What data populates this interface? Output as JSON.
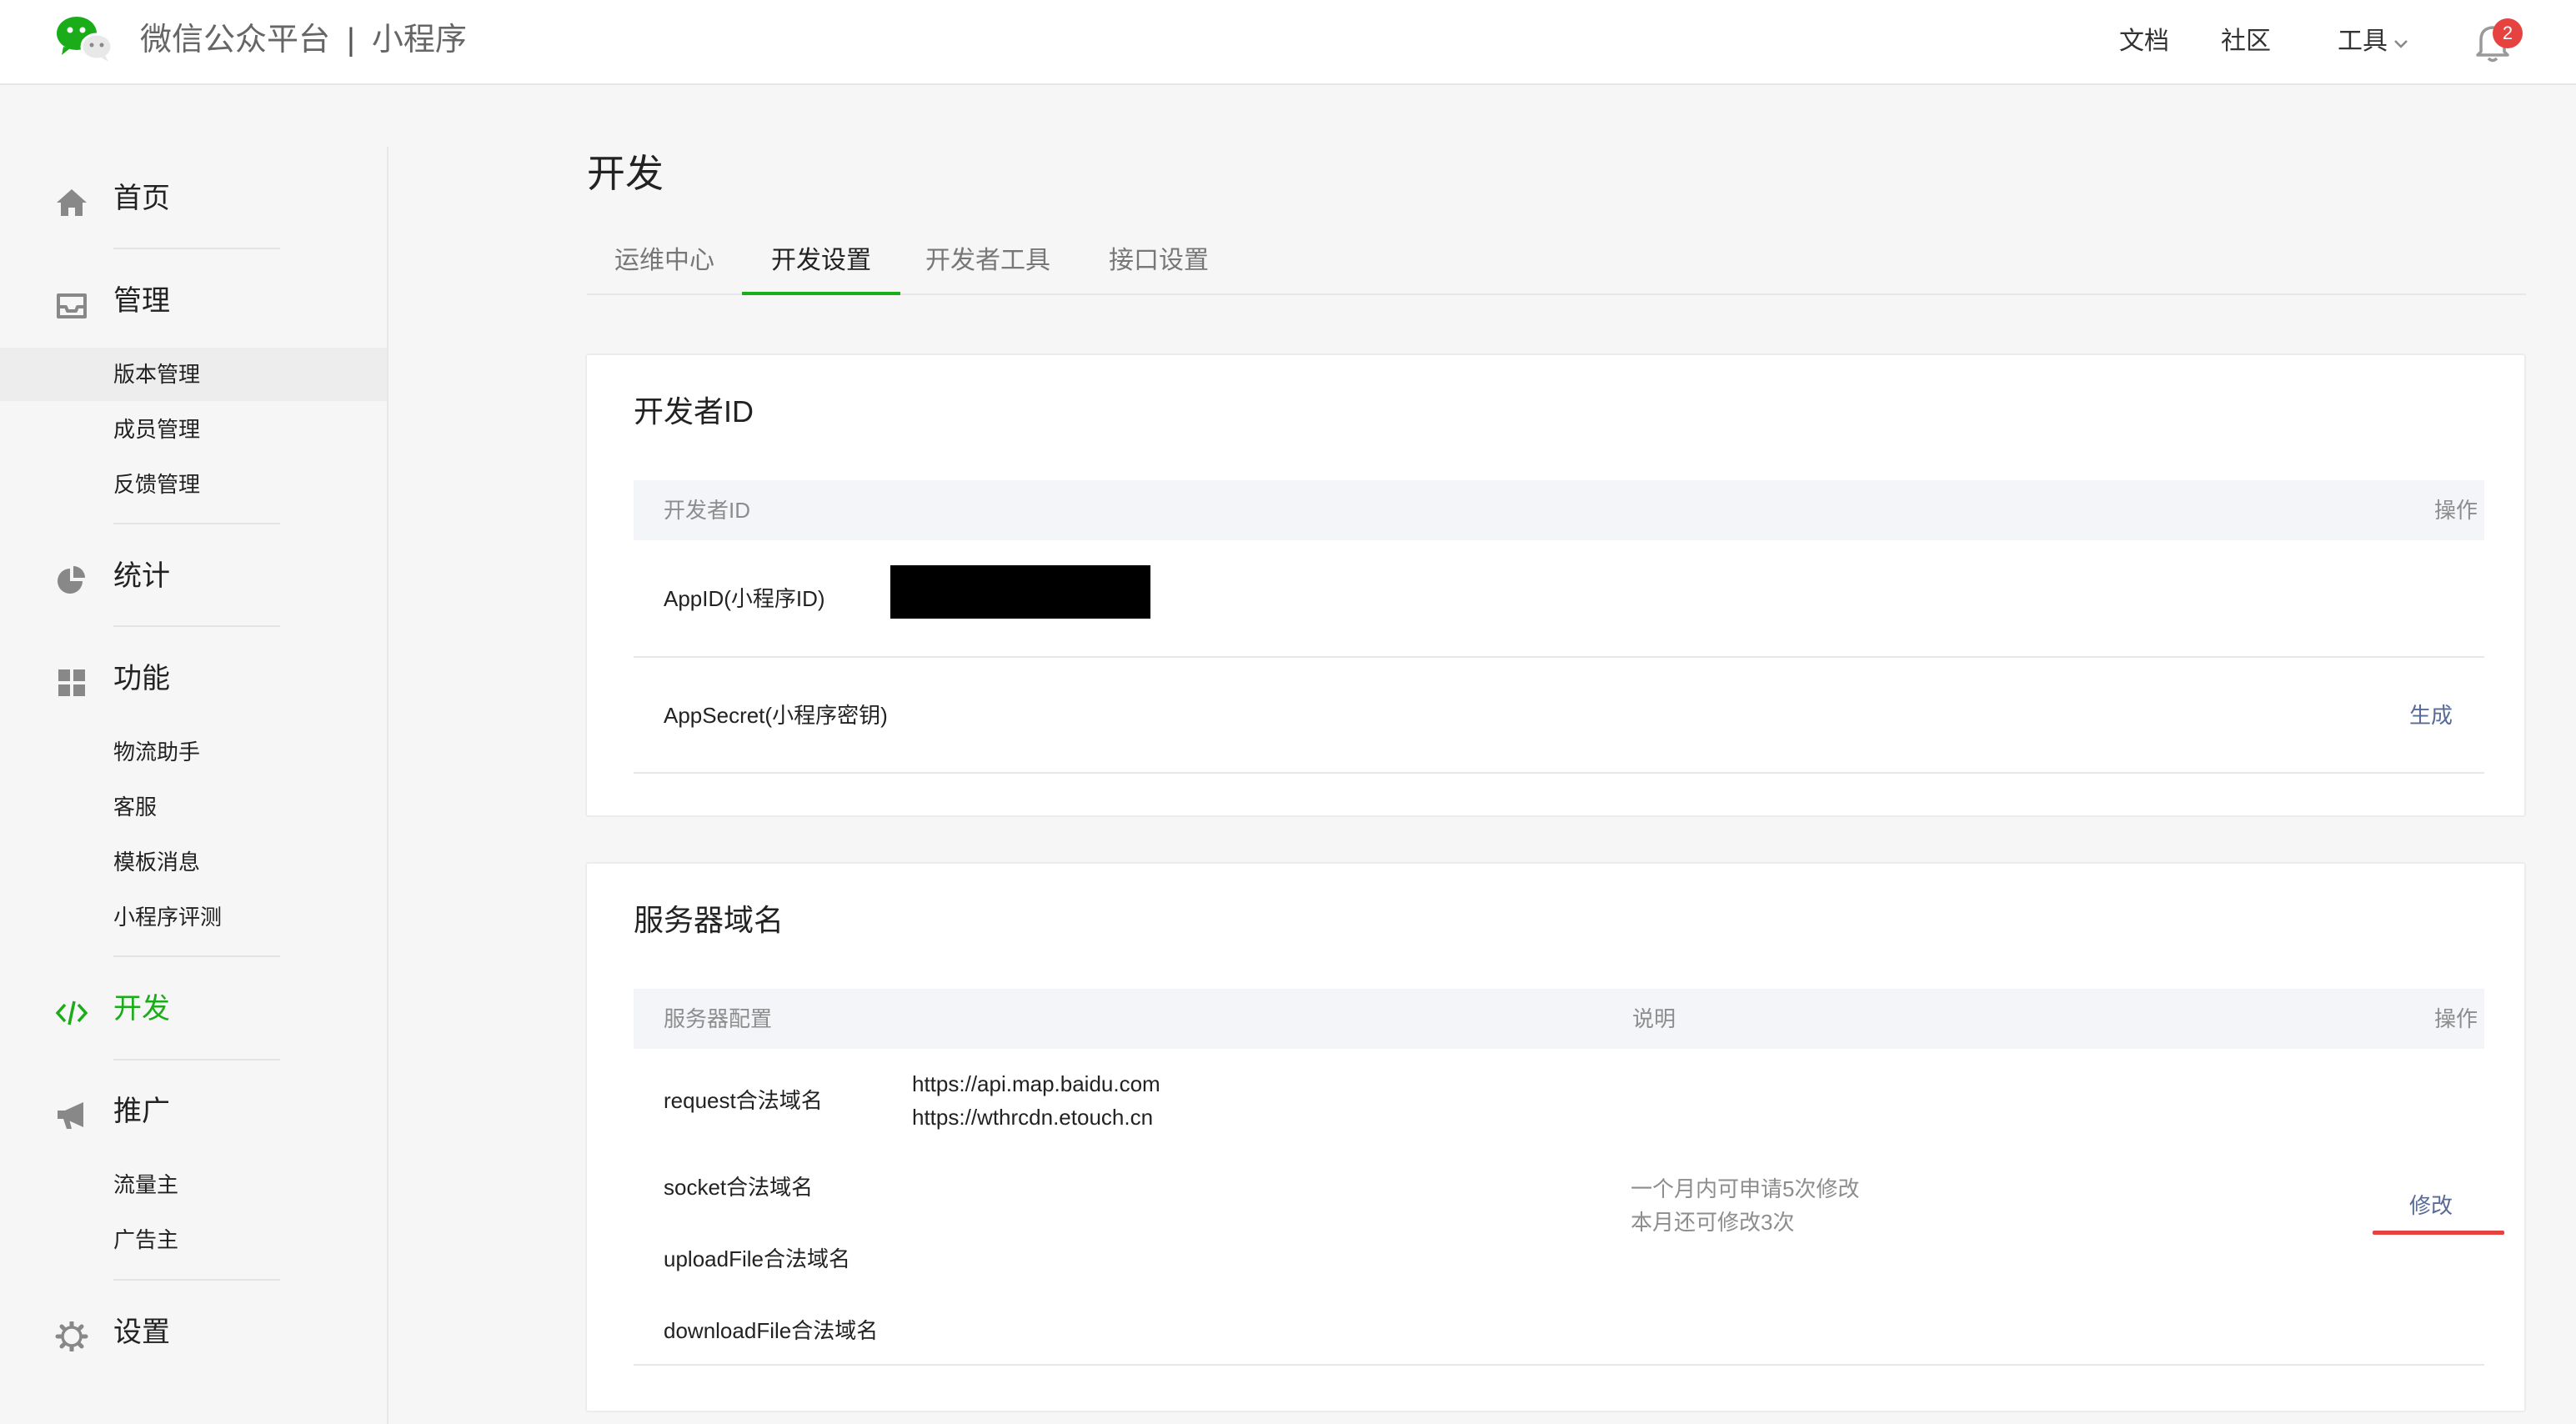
{
  "header": {
    "brand_name": "微信公众平台",
    "brand_separator": "|",
    "brand_product": "小程序",
    "nav": [
      {
        "label": "文档"
      },
      {
        "label": "社区"
      },
      {
        "label": "工具"
      }
    ],
    "notification_count": "2"
  },
  "sidebar": {
    "groups": [
      {
        "label": "首页",
        "icon": "home-icon",
        "items": []
      },
      {
        "label": "管理",
        "icon": "inbox-icon",
        "items": [
          {
            "label": "版本管理",
            "selected": true
          },
          {
            "label": "成员管理"
          },
          {
            "label": "反馈管理"
          }
        ]
      },
      {
        "label": "统计",
        "icon": "pie-chart-icon",
        "items": []
      },
      {
        "label": "功能",
        "icon": "grid-icon",
        "items": [
          {
            "label": "物流助手"
          },
          {
            "label": "客服"
          },
          {
            "label": "模板消息"
          },
          {
            "label": "小程序评测"
          }
        ]
      },
      {
        "label": "开发",
        "icon": "code-icon",
        "active": true,
        "items": []
      },
      {
        "label": "推广",
        "icon": "megaphone-icon",
        "items": [
          {
            "label": "流量主"
          },
          {
            "label": "广告主"
          }
        ]
      },
      {
        "label": "设置",
        "icon": "gear-icon",
        "items": []
      }
    ]
  },
  "main": {
    "page_title": "开发",
    "tabs": [
      {
        "label": "运维中心"
      },
      {
        "label": "开发设置",
        "active": true
      },
      {
        "label": "开发者工具"
      },
      {
        "label": "接口设置"
      }
    ],
    "developer_id": {
      "title": "开发者ID",
      "header_col1": "开发者ID",
      "header_action": "操作",
      "rows": [
        {
          "label": "AppID(小程序ID)"
        },
        {
          "label": "AppSecret(小程序密钥)",
          "action": "生成"
        }
      ]
    },
    "server_domain": {
      "title": "服务器域名",
      "header_col1": "服务器配置",
      "header_col2": "说明",
      "header_action": "操作",
      "rows": [
        {
          "label": "request合法域名",
          "values": [
            "https://api.map.baidu.com",
            "https://wthrcdn.etouch.cn"
          ]
        },
        {
          "label": "socket合法域名"
        },
        {
          "label": "uploadFile合法域名"
        },
        {
          "label": "downloadFile合法域名"
        }
      ],
      "notes": [
        "一个月内可申请5次修改",
        "本月还可修改3次"
      ],
      "action": "修改"
    }
  },
  "colors": {
    "accent_green": "#1aad19",
    "link_blue": "#576b95",
    "badge_red": "#e64340"
  }
}
